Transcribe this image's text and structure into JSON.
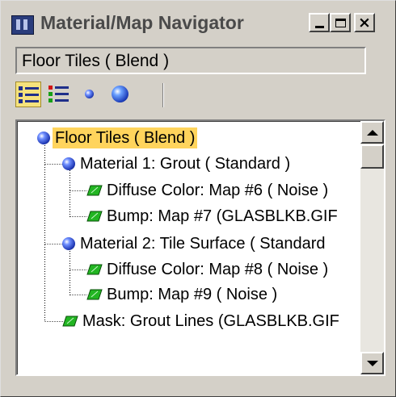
{
  "window": {
    "title": "Material/Map Navigator",
    "minimize_label": "",
    "maximize_label": "",
    "close_label": "×"
  },
  "name_field": {
    "value": "Floor Tiles  ( Blend )"
  },
  "toolbar": {
    "buttons": [
      {
        "icon": "list-view-icon",
        "active": true
      },
      {
        "icon": "list-view-with-icons-icon",
        "active": false
      },
      {
        "icon": "small-icons-icon",
        "active": false
      },
      {
        "icon": "large-icons-icon",
        "active": false
      }
    ]
  },
  "tree": {
    "nodes": [
      {
        "label": "Floor Tiles  ( Blend )",
        "type": "material",
        "level": 0,
        "selected": true
      },
      {
        "label": "Material 1: Grout  ( Standard )",
        "type": "material",
        "level": 1,
        "selected": false
      },
      {
        "label": "Diffuse Color: Map #6  ( Noise )",
        "type": "map",
        "level": 2,
        "selected": false
      },
      {
        "label": "Bump: Map #7 (GLASBLKB.GIF",
        "type": "map",
        "level": 2,
        "selected": false
      },
      {
        "label": "Material 2: Tile Surface  ( Standard",
        "type": "material",
        "level": 1,
        "selected": false
      },
      {
        "label": "Diffuse Color: Map #8  ( Noise )",
        "type": "map",
        "level": 2,
        "selected": false
      },
      {
        "label": "Bump: Map #9  ( Noise )",
        "type": "map",
        "level": 2,
        "selected": false
      },
      {
        "label": "Mask: Grout Lines (GLASBLKB.GIF",
        "type": "map",
        "level": 1,
        "selected": false
      }
    ]
  },
  "colors": {
    "selection_highlight": "#ffd45c",
    "active_tool": "#f5e27c",
    "map_icon": "#22b522",
    "material_sphere": "#1c34b0"
  }
}
